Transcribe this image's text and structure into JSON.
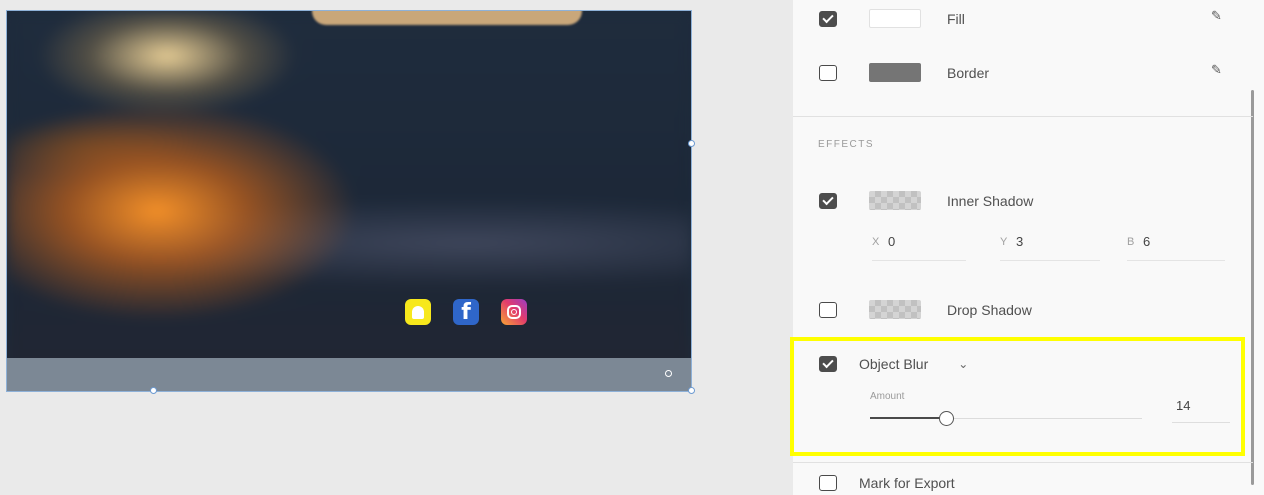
{
  "panel": {
    "appearance": {
      "fill": {
        "label": "Fill",
        "checked": true,
        "color": "#ffffff",
        "icon": "eyedropper-icon"
      },
      "border": {
        "label": "Border",
        "checked": false,
        "color": "#757575",
        "icon": "eyedropper-icon"
      }
    },
    "effects": {
      "title": "EFFECTS",
      "inner_shadow": {
        "label": "Inner Shadow",
        "checked": true,
        "x_label": "X",
        "x": "0",
        "y_label": "Y",
        "y": "3",
        "b_label": "B",
        "b": "6"
      },
      "drop_shadow": {
        "label": "Drop Shadow",
        "checked": false
      },
      "object_blur": {
        "label": "Object Blur",
        "checked": true,
        "dropdown_icon": "chevron-down-icon",
        "amount_label": "Amount",
        "amount": "14",
        "amount_fraction": 0.28
      },
      "highlight_color": "#ffff00"
    },
    "export": {
      "label": "Mark for Export",
      "checked": false
    }
  },
  "canvas": {
    "social_icons": [
      "snapchat-icon",
      "facebook-icon",
      "instagram-icon"
    ],
    "facebook_glyph": "f"
  }
}
